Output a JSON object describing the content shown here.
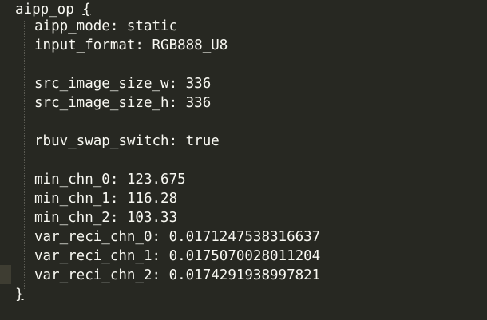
{
  "editor": {
    "lines": {
      "open": {
        "name": "aipp_op",
        "brace": "{"
      },
      "aipp_mode": "aipp_mode: static",
      "input_format": "input_format: RGB888_U8",
      "src_image_size_w": "src_image_size_w: 336",
      "src_image_size_h": "src_image_size_h: 336",
      "rbuv_swap_switch": "rbuv_swap_switch: true",
      "min_chn_0": "min_chn_0: 123.675",
      "min_chn_1": "min_chn_1: 116.28",
      "min_chn_2": "min_chn_2: 103.33",
      "var_reci_chn_0": "var_reci_chn_0: 0.0171247538316637",
      "var_reci_chn_1": "var_reci_chn_1: 0.0175070028011204",
      "var_reci_chn_2": "var_reci_chn_2: 0.0174291938997821",
      "close": "}"
    },
    "colors": {
      "background": "#272822",
      "text": "#f8f8f2",
      "current_line_marker": "#3e3d32"
    }
  }
}
